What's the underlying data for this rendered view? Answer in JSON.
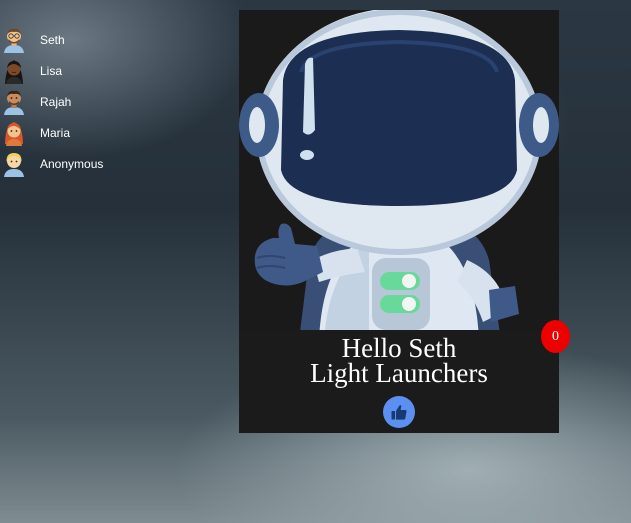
{
  "users": [
    {
      "name": "Seth",
      "icon": "man-with-glasses-avatar-icon"
    },
    {
      "name": "Lisa",
      "icon": "woman-dark-hair-avatar-icon"
    },
    {
      "name": "Rajah",
      "icon": "man-avatar-icon"
    },
    {
      "name": "Maria",
      "icon": "woman-red-hair-avatar-icon"
    },
    {
      "name": "Anonymous",
      "icon": "blonde-person-avatar-icon"
    }
  ],
  "card": {
    "greeting": "Hello Seth",
    "team": "Light Launchers",
    "image": "astronaut-thumbs-up-illustration",
    "like_icon": "thumbs-up-icon",
    "like_count": "0"
  },
  "colors": {
    "card_background": "#1b1b1b",
    "like_button": "#5b8ff0",
    "badge": "#ee0000"
  }
}
